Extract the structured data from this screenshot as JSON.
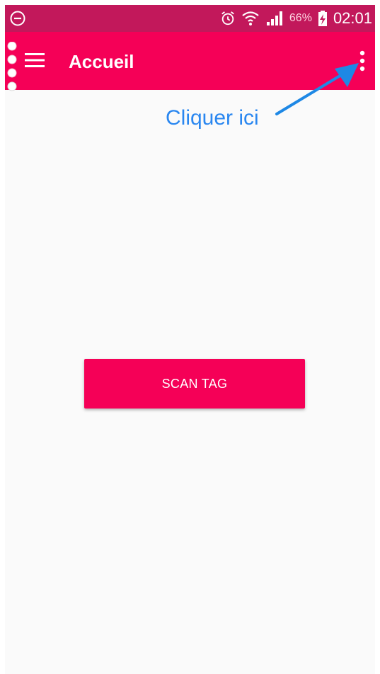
{
  "status_bar": {
    "icons": [
      "do-not-disturb-icon",
      "alarm-icon",
      "wifi-icon",
      "signal-icon",
      "battery-charging-icon"
    ],
    "battery_percent": "66%",
    "time": "02:01"
  },
  "app_bar": {
    "title": "Accueil",
    "menu_icon": "hamburger-menu-icon",
    "overflow_icon": "more-vert-icon"
  },
  "annotation": {
    "text": "Cliquer ici",
    "arrow_icon": "arrow-icon"
  },
  "main": {
    "scan_button_label": "SCAN TAG"
  },
  "colors": {
    "status_bar": "#c2185b",
    "app_bar": "#f50057",
    "accent": "#f50057",
    "background": "#fafafa",
    "annotation": "#2a87f0"
  }
}
